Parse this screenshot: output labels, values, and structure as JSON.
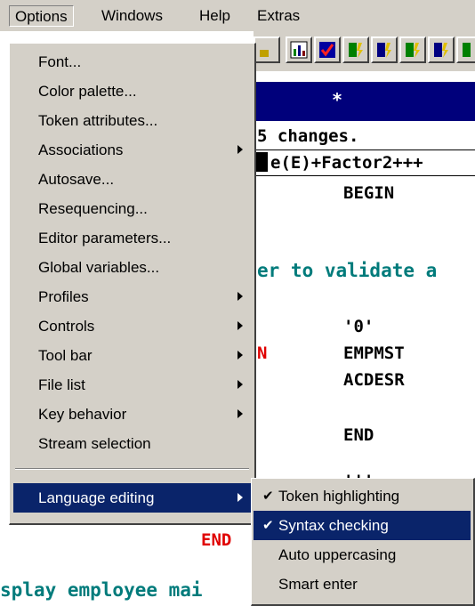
{
  "menubar": {
    "items": [
      {
        "label": "Options"
      },
      {
        "label": "Windows"
      },
      {
        "label": "Help"
      },
      {
        "label": "Extras"
      }
    ]
  },
  "editor": {
    "header_marker": "*",
    "lines": [
      "5 changes.",
      "e(E)+Factor2+++",
      "BEGIN",
      "er to validate a",
      "'0'",
      "EMPMST",
      "ACDESR",
      "END",
      "'''",
      "END",
      "splay employee mai"
    ],
    "red_marker": "N"
  },
  "options_menu": {
    "items": [
      {
        "label": "Font...",
        "submenu": false
      },
      {
        "label": "Color palette...",
        "submenu": false
      },
      {
        "label": "Token attributes...",
        "submenu": false
      },
      {
        "label": "Associations",
        "submenu": true
      },
      {
        "label": "Autosave...",
        "submenu": false
      },
      {
        "label": "Resequencing...",
        "submenu": false
      },
      {
        "label": "Editor parameters...",
        "submenu": false
      },
      {
        "label": "Global variables...",
        "submenu": false
      },
      {
        "label": "Profiles",
        "submenu": true
      },
      {
        "label": "Controls",
        "submenu": true
      },
      {
        "label": "Tool bar",
        "submenu": true
      },
      {
        "label": "File list",
        "submenu": true
      },
      {
        "label": "Key behavior",
        "submenu": true
      },
      {
        "label": "Stream selection",
        "submenu": false
      },
      {
        "label": "Language editing",
        "submenu": true,
        "highlighted": true
      }
    ]
  },
  "language_menu": {
    "items": [
      {
        "label": "Token highlighting",
        "checked": true
      },
      {
        "label": "Syntax checking",
        "checked": true,
        "highlighted": true
      },
      {
        "label": "Auto uppercasing",
        "checked": false
      },
      {
        "label": "Smart enter",
        "checked": false
      }
    ]
  },
  "check_glyph": "✔",
  "colors": {
    "menu_bg": "#d4d0c8",
    "highlight": "#0a246a",
    "editor_header": "#00007b",
    "teal_text": "#007b7b",
    "red_text": "#e00000"
  }
}
